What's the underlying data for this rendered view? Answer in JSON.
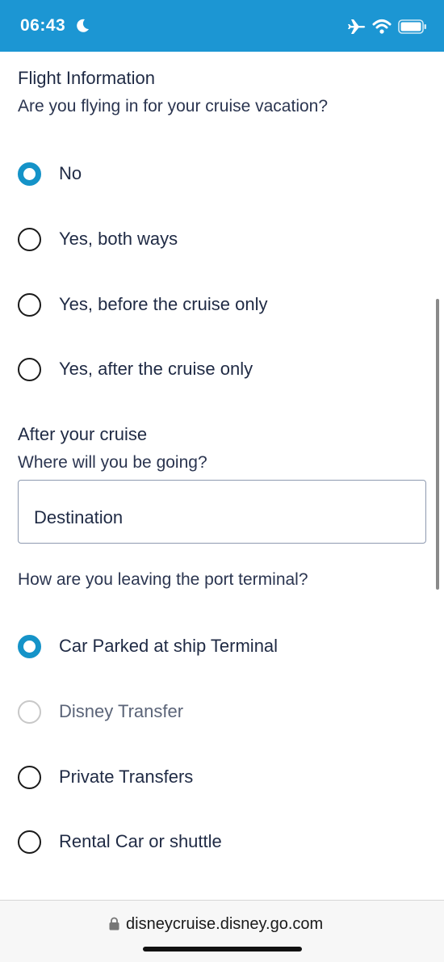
{
  "status_bar": {
    "time": "06:43",
    "background": "#1c96d3"
  },
  "flight": {
    "title": "Flight Information",
    "question": "Are you flying in for your cruise vacation?",
    "options": [
      {
        "label": "No",
        "checked": true
      },
      {
        "label": "Yes, both ways",
        "checked": false
      },
      {
        "label": "Yes, before the cruise only",
        "checked": false
      },
      {
        "label": "Yes, after the cruise only",
        "checked": false
      }
    ]
  },
  "after_cruise": {
    "title": "After your cruise",
    "question": "Where will you be going?",
    "destination_value": "Destination"
  },
  "port_terminal": {
    "question": "How are you leaving the port terminal?",
    "options": [
      {
        "label": "Car Parked at ship Terminal",
        "checked": true
      },
      {
        "label": "Disney Transfer",
        "checked": false,
        "disabled": true
      },
      {
        "label": "Private Transfers",
        "checked": false
      },
      {
        "label": "Rental Car or shuttle",
        "checked": false
      }
    ]
  },
  "browser": {
    "url": "disneycruise.disney.go.com"
  },
  "colors": {
    "accent": "#1593c8",
    "text": "#1f2a44"
  }
}
